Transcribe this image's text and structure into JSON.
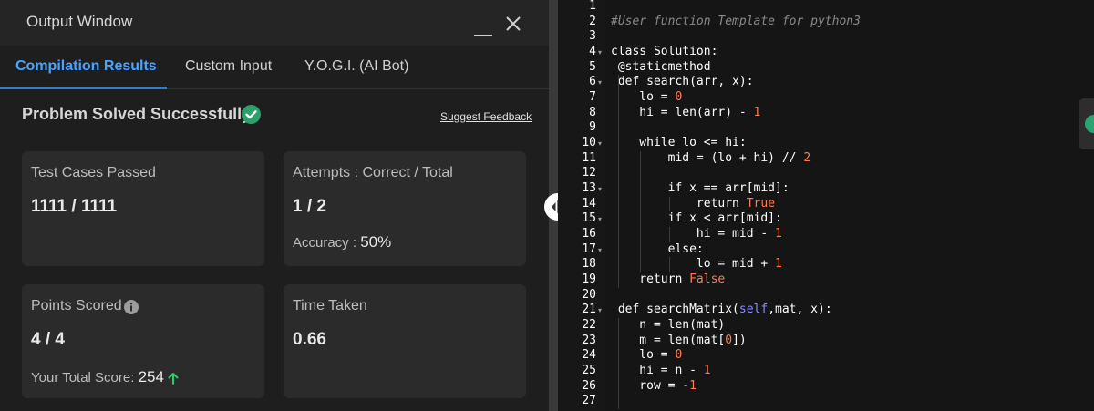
{
  "output_window": {
    "title": "Output Window",
    "minimize_icon": "minimize-icon",
    "close_icon": "close-icon"
  },
  "tabs": [
    {
      "label": "Compilation Results",
      "active": true
    },
    {
      "label": "Custom Input",
      "active": false
    },
    {
      "label": "Y.O.G.I. (AI Bot)",
      "active": false
    }
  ],
  "status": {
    "text": "Problem Solved Successfully",
    "icon": "check-circle-icon",
    "feedback_link": "Suggest Feedback"
  },
  "cards": {
    "test_cases": {
      "label": "Test Cases Passed",
      "value": "1111 / 1111"
    },
    "attempts": {
      "label": "Attempts : Correct / Total",
      "value": "1 / 2",
      "accuracy_label": "Accuracy :",
      "accuracy_value": "50%"
    },
    "points": {
      "label": "Points Scored",
      "value": "4 / 4",
      "total_label": "Your Total Score:",
      "total_value": "254",
      "info_icon": "info-icon",
      "trend_icon": "arrow-up-icon"
    },
    "time": {
      "label": "Time Taken",
      "value": "0.66"
    }
  },
  "editor": {
    "line_numbers": [
      "1",
      "2",
      "3",
      "4",
      "5",
      "6",
      "7",
      "8",
      "9",
      "10",
      "11",
      "12",
      "13",
      "14",
      "15",
      "16",
      "17",
      "18",
      "19",
      "20",
      "21",
      "22",
      "23",
      "24",
      "25",
      "26",
      "27"
    ],
    "fold_lines": [
      4,
      6,
      10,
      13,
      15,
      17,
      21
    ],
    "lines": [
      "",
      "#User function Template for python3",
      "",
      "class Solution:",
      " @staticmethod",
      " def search(arr, x):",
      "    lo = 0",
      "    hi = len(arr) - 1",
      "",
      "    while lo <= hi:",
      "        mid = (lo + hi) // 2",
      "",
      "        if x == arr[mid]:",
      "            return True",
      "        if x < arr[mid]:",
      "            hi = mid - 1",
      "        else:",
      "            lo = mid + 1",
      "    return False",
      "",
      " def searchMatrix(self,mat, x):",
      "    n = len(mat)",
      "    m = len(mat[0])",
      "    lo = 0",
      "    hi = n - 1",
      "    row = -1",
      ""
    ]
  },
  "colors": {
    "accent_tab": "#4aa3ff",
    "success": "#2e9e6b",
    "number": "#ff7b50",
    "comment": "#8a8a8a"
  }
}
